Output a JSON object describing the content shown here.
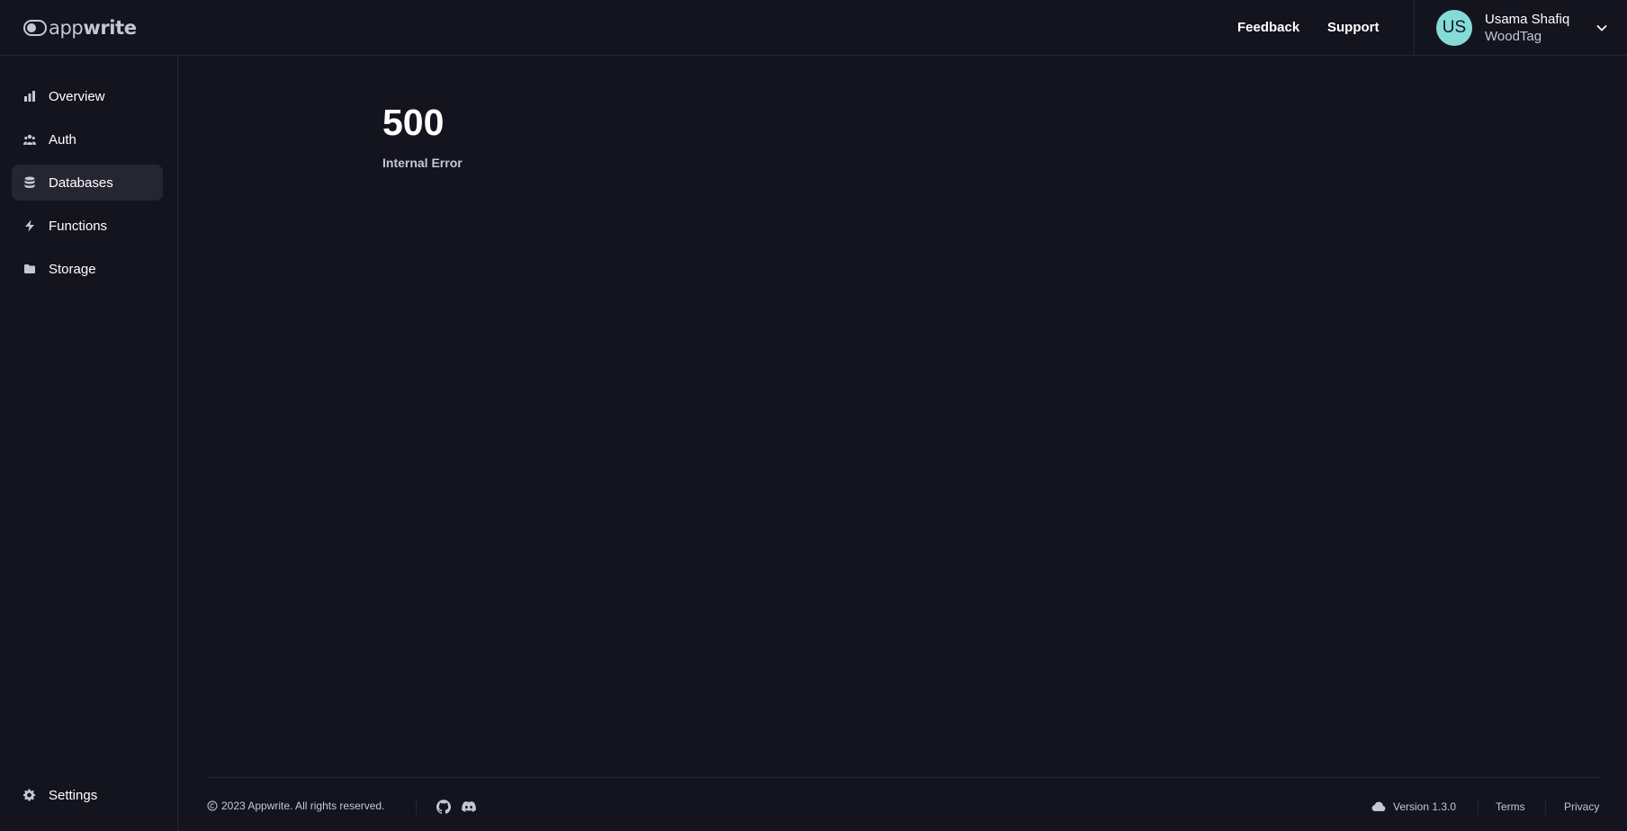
{
  "brand": {
    "name_light": "app",
    "name_bold": "write"
  },
  "header": {
    "feedback": "Feedback",
    "support": "Support",
    "user": {
      "initials": "US",
      "name": "Usama Shafiq",
      "organization": "WoodTag",
      "avatar_color": "#85dbd8"
    }
  },
  "sidebar": {
    "items": [
      {
        "label": "Overview",
        "icon": "chart-bar-icon",
        "active": false
      },
      {
        "label": "Auth",
        "icon": "users-icon",
        "active": false
      },
      {
        "label": "Databases",
        "icon": "database-icon",
        "active": true
      },
      {
        "label": "Functions",
        "icon": "lightning-bolt-icon",
        "active": false
      },
      {
        "label": "Storage",
        "icon": "folder-icon",
        "active": false
      }
    ],
    "settings": {
      "label": "Settings",
      "icon": "cog-icon"
    }
  },
  "error": {
    "code": "500",
    "message": "Internal Error"
  },
  "footer": {
    "copyright": "2023 Appwrite. All rights reserved.",
    "social_icons": [
      "github-icon",
      "discord-icon"
    ],
    "version": "Version 1.3.0",
    "terms": "Terms",
    "privacy": "Privacy"
  },
  "colors": {
    "background": "#14141f",
    "active_item": "#262633",
    "border": "#262630",
    "text_primary": "#ffffff",
    "text_secondary": "#c5c7d4"
  }
}
